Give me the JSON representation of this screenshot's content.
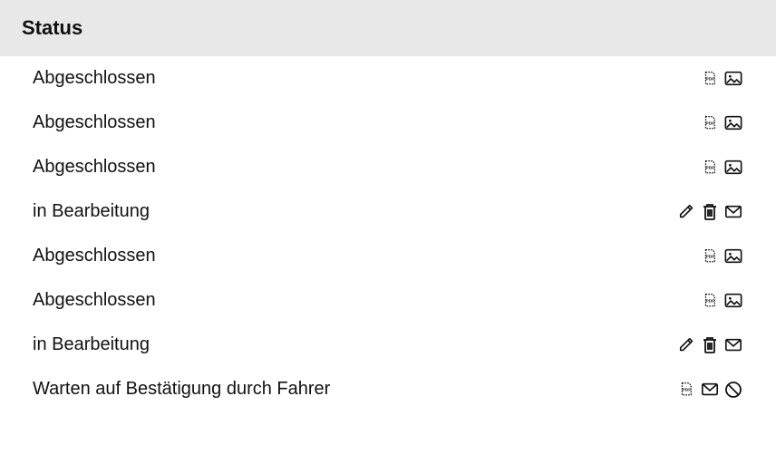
{
  "header": {
    "title": "Status"
  },
  "rows": [
    {
      "status": "Abgeschlossen",
      "actions": [
        "pdf",
        "image"
      ]
    },
    {
      "status": "Abgeschlossen",
      "actions": [
        "pdf",
        "image"
      ]
    },
    {
      "status": "Abgeschlossen",
      "actions": [
        "pdf",
        "image"
      ]
    },
    {
      "status": "in Bearbeitung",
      "actions": [
        "edit",
        "delete",
        "mail"
      ]
    },
    {
      "status": "Abgeschlossen",
      "actions": [
        "pdf",
        "image"
      ]
    },
    {
      "status": "Abgeschlossen",
      "actions": [
        "pdf",
        "image"
      ]
    },
    {
      "status": "in Bearbeitung",
      "actions": [
        "edit",
        "delete",
        "mail"
      ]
    },
    {
      "status": "Warten auf Bestätigung durch Fahrer",
      "actions": [
        "pdf",
        "mail",
        "cancel"
      ]
    }
  ],
  "icons": {
    "pdf": "pdf-icon",
    "image": "image-icon",
    "edit": "edit-icon",
    "delete": "trash-icon",
    "mail": "envelope-icon",
    "cancel": "cancel-icon"
  }
}
